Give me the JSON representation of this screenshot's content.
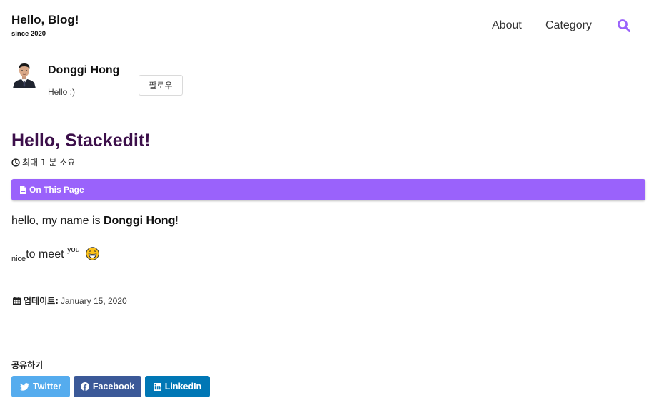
{
  "header": {
    "site_title": "Hello, Blog!",
    "site_subtitle": "since 2020",
    "nav": [
      {
        "label": "About"
      },
      {
        "label": "Category"
      }
    ],
    "search_icon": "search-icon"
  },
  "author": {
    "name": "Donggi Hong",
    "bio": "Hello :)",
    "follow_label": "팔로우"
  },
  "post": {
    "title": "Hello, Stackedit!",
    "read_time": "최대 1 분 소요",
    "toc_label": "On This Page",
    "para1_prefix": "hello, my name is ",
    "para1_bold": "Donggi Hong",
    "para1_suffix": "!",
    "para2_sub": "nice",
    "para2_main": "to meet ",
    "para2_sup": "you",
    "updated_label": "업데이트:",
    "updated_date": "January 15, 2020"
  },
  "share": {
    "heading": "공유하기",
    "twitter": "Twitter",
    "facebook": "Facebook",
    "linkedin": "LinkedIn"
  },
  "colors": {
    "accent": "#9a62fb",
    "title": "#3c0f4a",
    "twitter": "#55acee",
    "facebook": "#3b5998",
    "linkedin": "#0077b5"
  }
}
